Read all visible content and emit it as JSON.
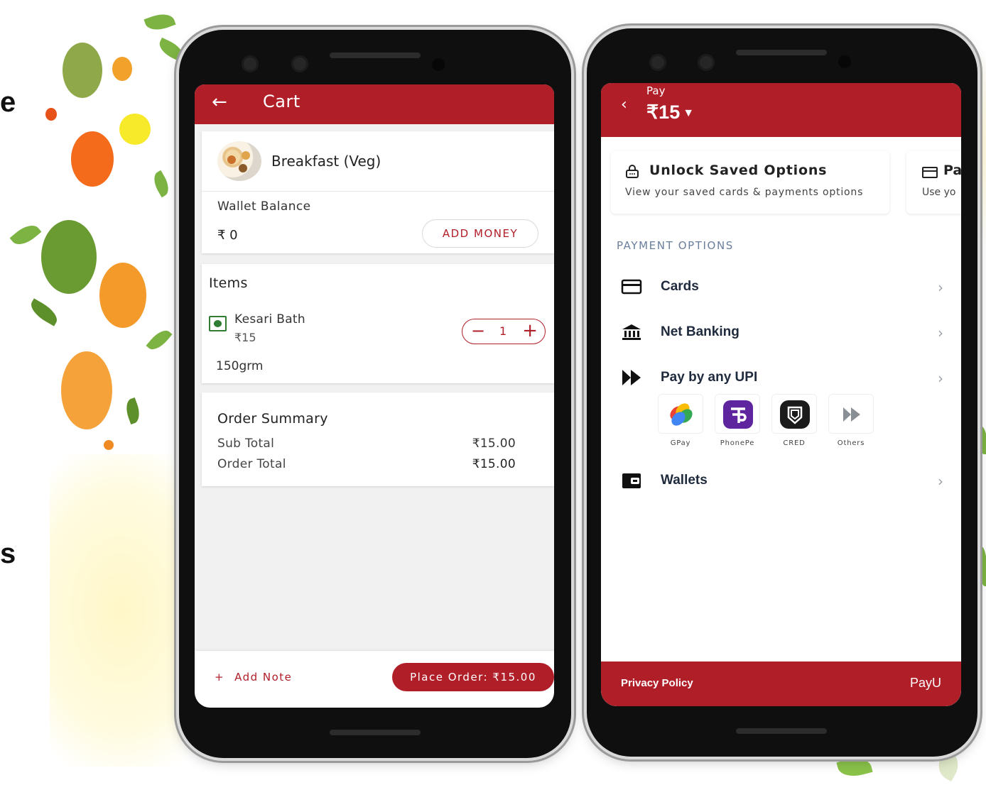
{
  "side_text": {
    "top": "e",
    "bottom": "s"
  },
  "cart_screen": {
    "title": "Cart",
    "meal_title": "Breakfast (Veg)",
    "wallet_label": "Wallet Balance",
    "wallet_value": "₹ 0",
    "add_money": "ADD MONEY",
    "items_heading": "Items",
    "item": {
      "name": "Kesari Bath",
      "price": "₹15",
      "quantity": "1",
      "weight": "150grm"
    },
    "summary": {
      "heading": "Order Summary",
      "sub_total_label": "Sub Total",
      "sub_total_value": "₹15.00",
      "order_total_label": "Order Total",
      "order_total_value": "₹15.00"
    },
    "add_note": "Add Note",
    "place_order": "Place Order: ₹15.00"
  },
  "pay_screen": {
    "label": "Pay",
    "amount": "₹15",
    "saved_title": "Unlock Saved Options",
    "saved_subtitle": "View your saved cards & payments options",
    "saved_title_2": "Pa",
    "saved_subtitle_2": "Use yo",
    "section_label": "PAYMENT OPTIONS",
    "options": [
      {
        "label": "Cards",
        "icon": "card-icon"
      },
      {
        "label": "Net Banking",
        "icon": "bank-icon"
      },
      {
        "label": "Pay by any UPI",
        "icon": "upi-icon"
      },
      {
        "label": "Wallets",
        "icon": "wallet-icon"
      }
    ],
    "upi_apps": [
      "GPay",
      "PhonePe",
      "CRED",
      "Others"
    ],
    "privacy": "Privacy Policy",
    "brand": "PayU"
  },
  "colors": {
    "brand_red": "#b01e28",
    "section_label": "#6a7f9c",
    "veg_green": "#2e7d32"
  }
}
